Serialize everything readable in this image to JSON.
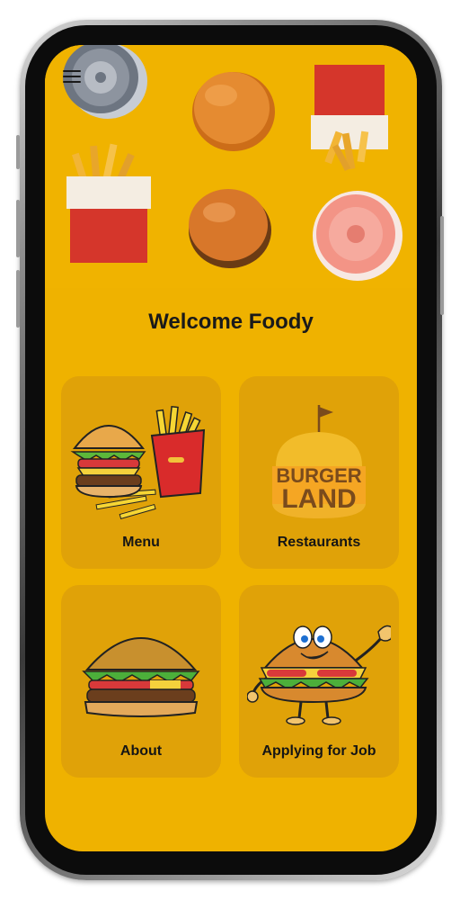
{
  "app": {
    "title": "Welcome Foody"
  },
  "menu": {
    "icon": "hamburger-menu-icon"
  },
  "cards": [
    {
      "label": "Menu",
      "icon": "burger-fries-icon"
    },
    {
      "label": "Restaurants",
      "icon": "burger-land-logo",
      "logo_text": [
        "BURGER",
        "LAND"
      ]
    },
    {
      "label": "About",
      "icon": "burger-icon"
    },
    {
      "label": "Applying for Job",
      "icon": "burger-mascot-icon"
    }
  ],
  "colors": {
    "background": "#efb200",
    "card": "#e0a208",
    "text": "#1a1a1a"
  }
}
